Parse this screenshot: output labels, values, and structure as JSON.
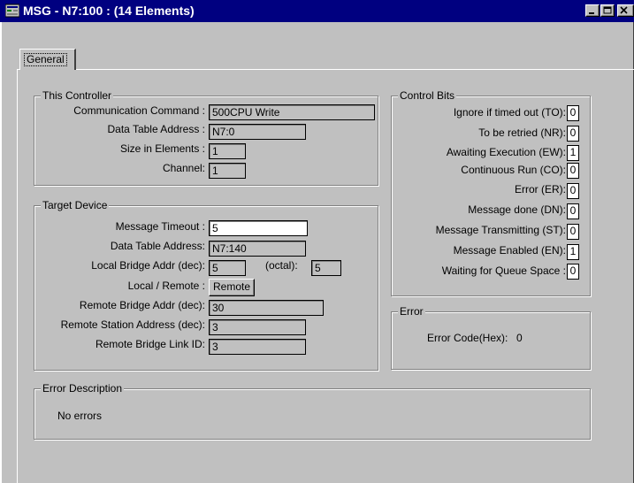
{
  "window": {
    "title": "MSG - N7:100 : (14 Elements)",
    "titlebar_color": "#000080",
    "background_color": "#c0c0c0"
  },
  "tabs": [
    {
      "label": "General",
      "selected": true
    }
  ],
  "this_controller": {
    "title": "This Controller",
    "communication_command_label": "Communication Command :",
    "communication_command_value": "500CPU Write",
    "data_table_address_label": "Data Table Address :",
    "data_table_address_value": "N7:0",
    "size_in_elements_label": "Size in Elements :",
    "size_in_elements_value": "1",
    "channel_label": "Channel:",
    "channel_value": "1"
  },
  "target_device": {
    "title": "Target Device",
    "message_timeout_label": "Message Timeout :",
    "message_timeout_value": "5",
    "data_table_address_label": "Data Table Address:",
    "data_table_address_value": "N7:140",
    "local_bridge_addr_label": "Local Bridge Addr (dec):",
    "local_bridge_addr_value": "5",
    "octal_label": "(octal):",
    "octal_value": "5",
    "local_remote_label": "Local / Remote :",
    "local_remote_value": "Remote",
    "remote_bridge_addr_label": "Remote Bridge Addr (dec):",
    "remote_bridge_addr_value": "30",
    "remote_station_address_label": "Remote Station Address (dec):",
    "remote_station_address_value": "3",
    "remote_bridge_link_id_label": "Remote Bridge Link ID:",
    "remote_bridge_link_id_value": "3"
  },
  "control_bits": {
    "title": "Control Bits",
    "items": [
      {
        "label": "Ignore if timed out (TO):",
        "value": "0"
      },
      {
        "label": "To be retried (NR):",
        "value": "0"
      },
      {
        "label": "Awaiting Execution (EW):",
        "value": "1"
      },
      {
        "label": "Continuous Run (CO):",
        "value": "0"
      },
      {
        "label": "Error (ER):",
        "value": "0"
      },
      {
        "label": "Message done (DN):",
        "value": "0"
      },
      {
        "label": "Message Transmitting (ST):",
        "value": "0"
      },
      {
        "label": "Message Enabled (EN):",
        "value": "1"
      },
      {
        "label": "Waiting for Queue Space :",
        "value": "0"
      }
    ]
  },
  "error": {
    "title": "Error",
    "error_code_label": "Error Code(Hex):",
    "error_code_value": "0"
  },
  "error_description": {
    "title": "Error Description",
    "text": "No errors"
  }
}
